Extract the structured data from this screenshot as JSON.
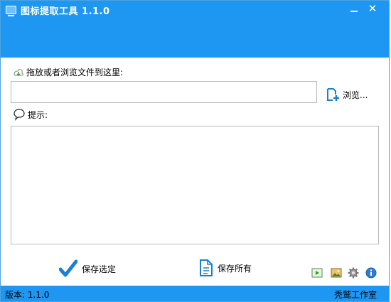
{
  "window": {
    "title": "图标提取工具 1.1.0",
    "minimize_icon": "minimize-icon",
    "close_glyph": "✕"
  },
  "drop_area": {
    "label": "拖放或者浏览文件到这里:",
    "input_value": "",
    "browse_label": "浏览..."
  },
  "tips": {
    "label": "提示:",
    "content": ""
  },
  "actions": {
    "save_selected_label": "保存选定",
    "save_all_label": "保存所有"
  },
  "tools": [
    "play-icon",
    "image-icon",
    "gear-icon",
    "info-icon"
  ],
  "status": {
    "version": "版本: 1.1.0",
    "studio": "秃鹫工作室"
  },
  "colors": {
    "titlebar": "#1e97f3",
    "accent": "#1a7fd6"
  }
}
